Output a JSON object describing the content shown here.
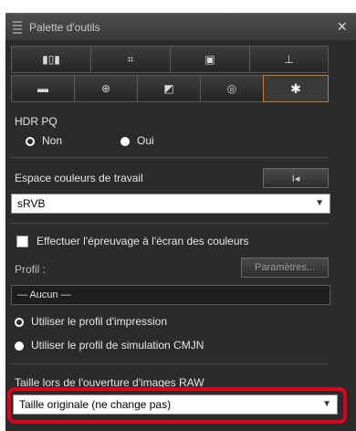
{
  "window": {
    "title": "Palette d'outils",
    "close_glyph": "×"
  },
  "toolbar_row1": [
    {
      "icon": "tone-curve-icon",
      "glyph": "▮▯▮"
    },
    {
      "icon": "crop-icon",
      "glyph": "⌗"
    },
    {
      "icon": "image-icon",
      "glyph": "▣"
    },
    {
      "icon": "level-icon",
      "glyph": "⊥"
    }
  ],
  "toolbar_row2": [
    {
      "icon": "gradient-icon",
      "glyph": "▬"
    },
    {
      "icon": "zoom-detail-icon",
      "glyph": "⊕"
    },
    {
      "icon": "adjust-icon",
      "glyph": "◩"
    },
    {
      "icon": "color-icon",
      "glyph": "◎"
    },
    {
      "icon": "gear-icon",
      "glyph": "✱"
    }
  ],
  "hdr": {
    "label": "HDR PQ",
    "options": [
      {
        "label": "Non",
        "selected": false
      },
      {
        "label": "Oui",
        "selected": true
      }
    ]
  },
  "workspace": {
    "label": "Espace couleurs de travail",
    "reset_glyph": "I◂",
    "value": "sRVB"
  },
  "proof": {
    "checkbox_label": "Effectuer l'épreuvage à l'écran des couleurs",
    "checked": false,
    "profile_label": "Profil :",
    "settings_button": "Paramètres...",
    "profile_value": "— Aucun —",
    "options": [
      {
        "label": "Utiliser le profil d'impression",
        "selected": false
      },
      {
        "label": "Utiliser le profil de simulation CMJN",
        "selected": true
      }
    ]
  },
  "raw": {
    "label": "Taille lors de l'ouverture d'images RAW",
    "value": "Taille originale (ne change pas)"
  },
  "colors": {
    "highlight": "#e0001b",
    "active_tab_border": "#c87c2a",
    "panel_bg": "#2b2b2b"
  }
}
